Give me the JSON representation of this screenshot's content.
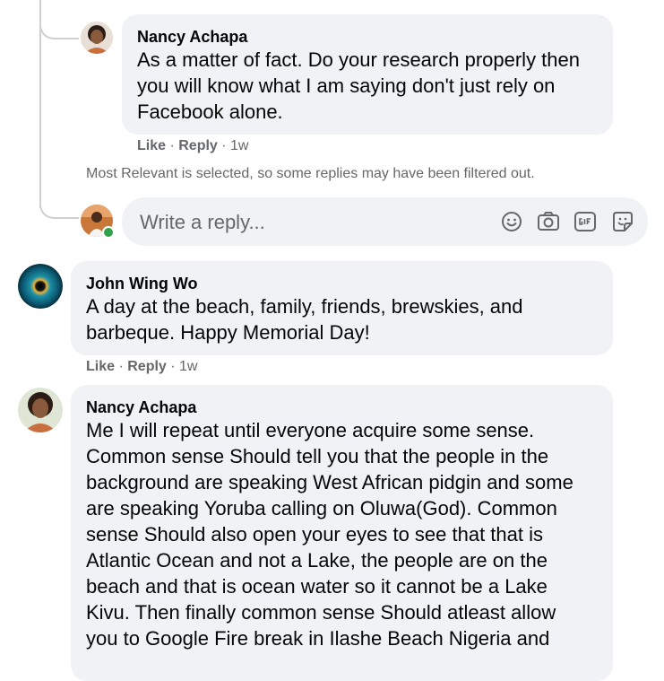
{
  "thread": {
    "reply1": {
      "author": "Nancy Achapa",
      "text": "As a matter of fact. Do your research properly then\nyou will know what I am saying don't just rely on\nFacebook alone.",
      "like": "Like",
      "sep1": " · ",
      "reply": "Reply",
      "sep2": " · ",
      "time": "1w"
    },
    "filter_notice": "Most Relevant is selected, so some replies may have been filtered out.",
    "reply_box": {
      "placeholder": "Write a reply...",
      "icons": [
        "emoji-icon",
        "camera-icon",
        "gif-icon",
        "sticker-icon"
      ]
    }
  },
  "comments": [
    {
      "author": "John Wing Wo",
      "text": "A day at the beach, family, friends, brewskies, and\nbarbeque. Happy Memorial Day!",
      "like": "Like",
      "sep1": " · ",
      "reply": "Reply",
      "sep2": " · ",
      "time": "1w"
    },
    {
      "author": "Nancy Achapa",
      "text": "Me I will repeat until everyone acquire some sense.\nCommon sense Should tell you that the people in the\nbackground are speaking West African pidgin and some\nare speaking Yoruba calling on Oluwa(God). Common\nsense Should also open your eyes to see that that is\nAtlantic Ocean and not a Lake, the people are on the\nbeach and that is ocean water so it cannot be a Lake\nKivu. Then finally common sense Should atleast allow\nyou to Google Fire break in Ilashe Beach Nigeria and"
    }
  ],
  "colors": {
    "bubble": "#f0f2f5",
    "meta": "#65676b",
    "online": "#31a24c",
    "line": "#ced0d4"
  }
}
